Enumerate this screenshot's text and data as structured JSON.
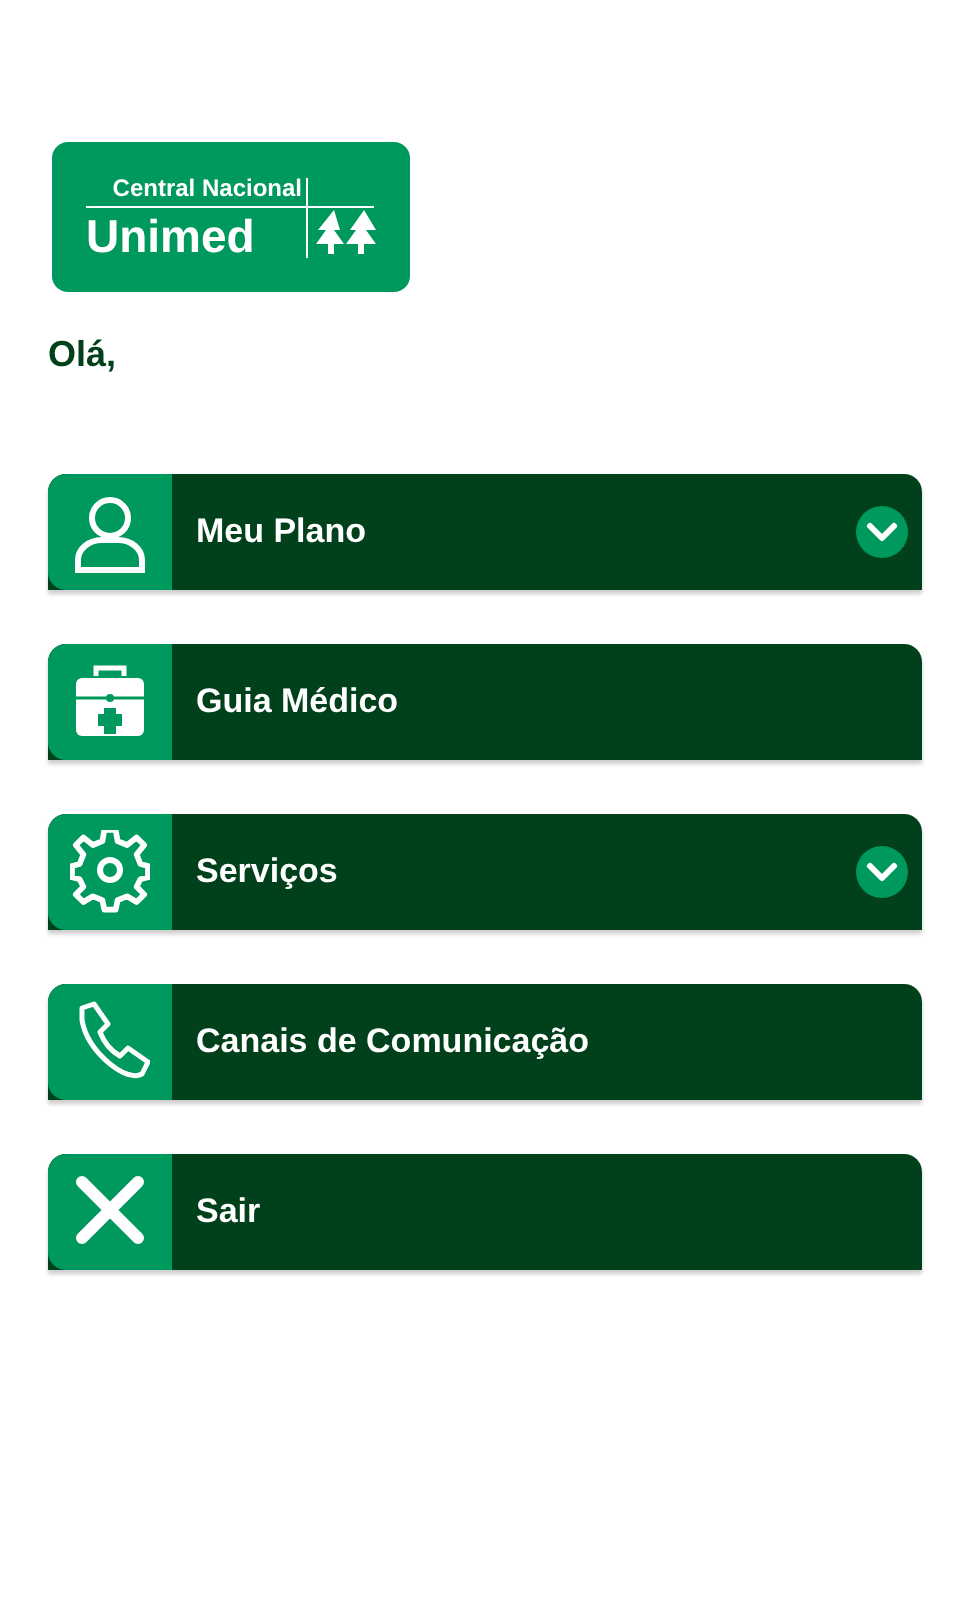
{
  "logo": {
    "line_1": "Central Nacional",
    "line_2": "Unimed"
  },
  "greeting": "Olá,",
  "menu": [
    {
      "label": "Meu Plano",
      "expandable": true
    },
    {
      "label": "Guia Médico",
      "expandable": false
    },
    {
      "label": "Serviços",
      "expandable": true
    },
    {
      "label": "Canais de Comunicação",
      "expandable": false
    },
    {
      "label": "Sair",
      "expandable": false
    }
  ]
}
